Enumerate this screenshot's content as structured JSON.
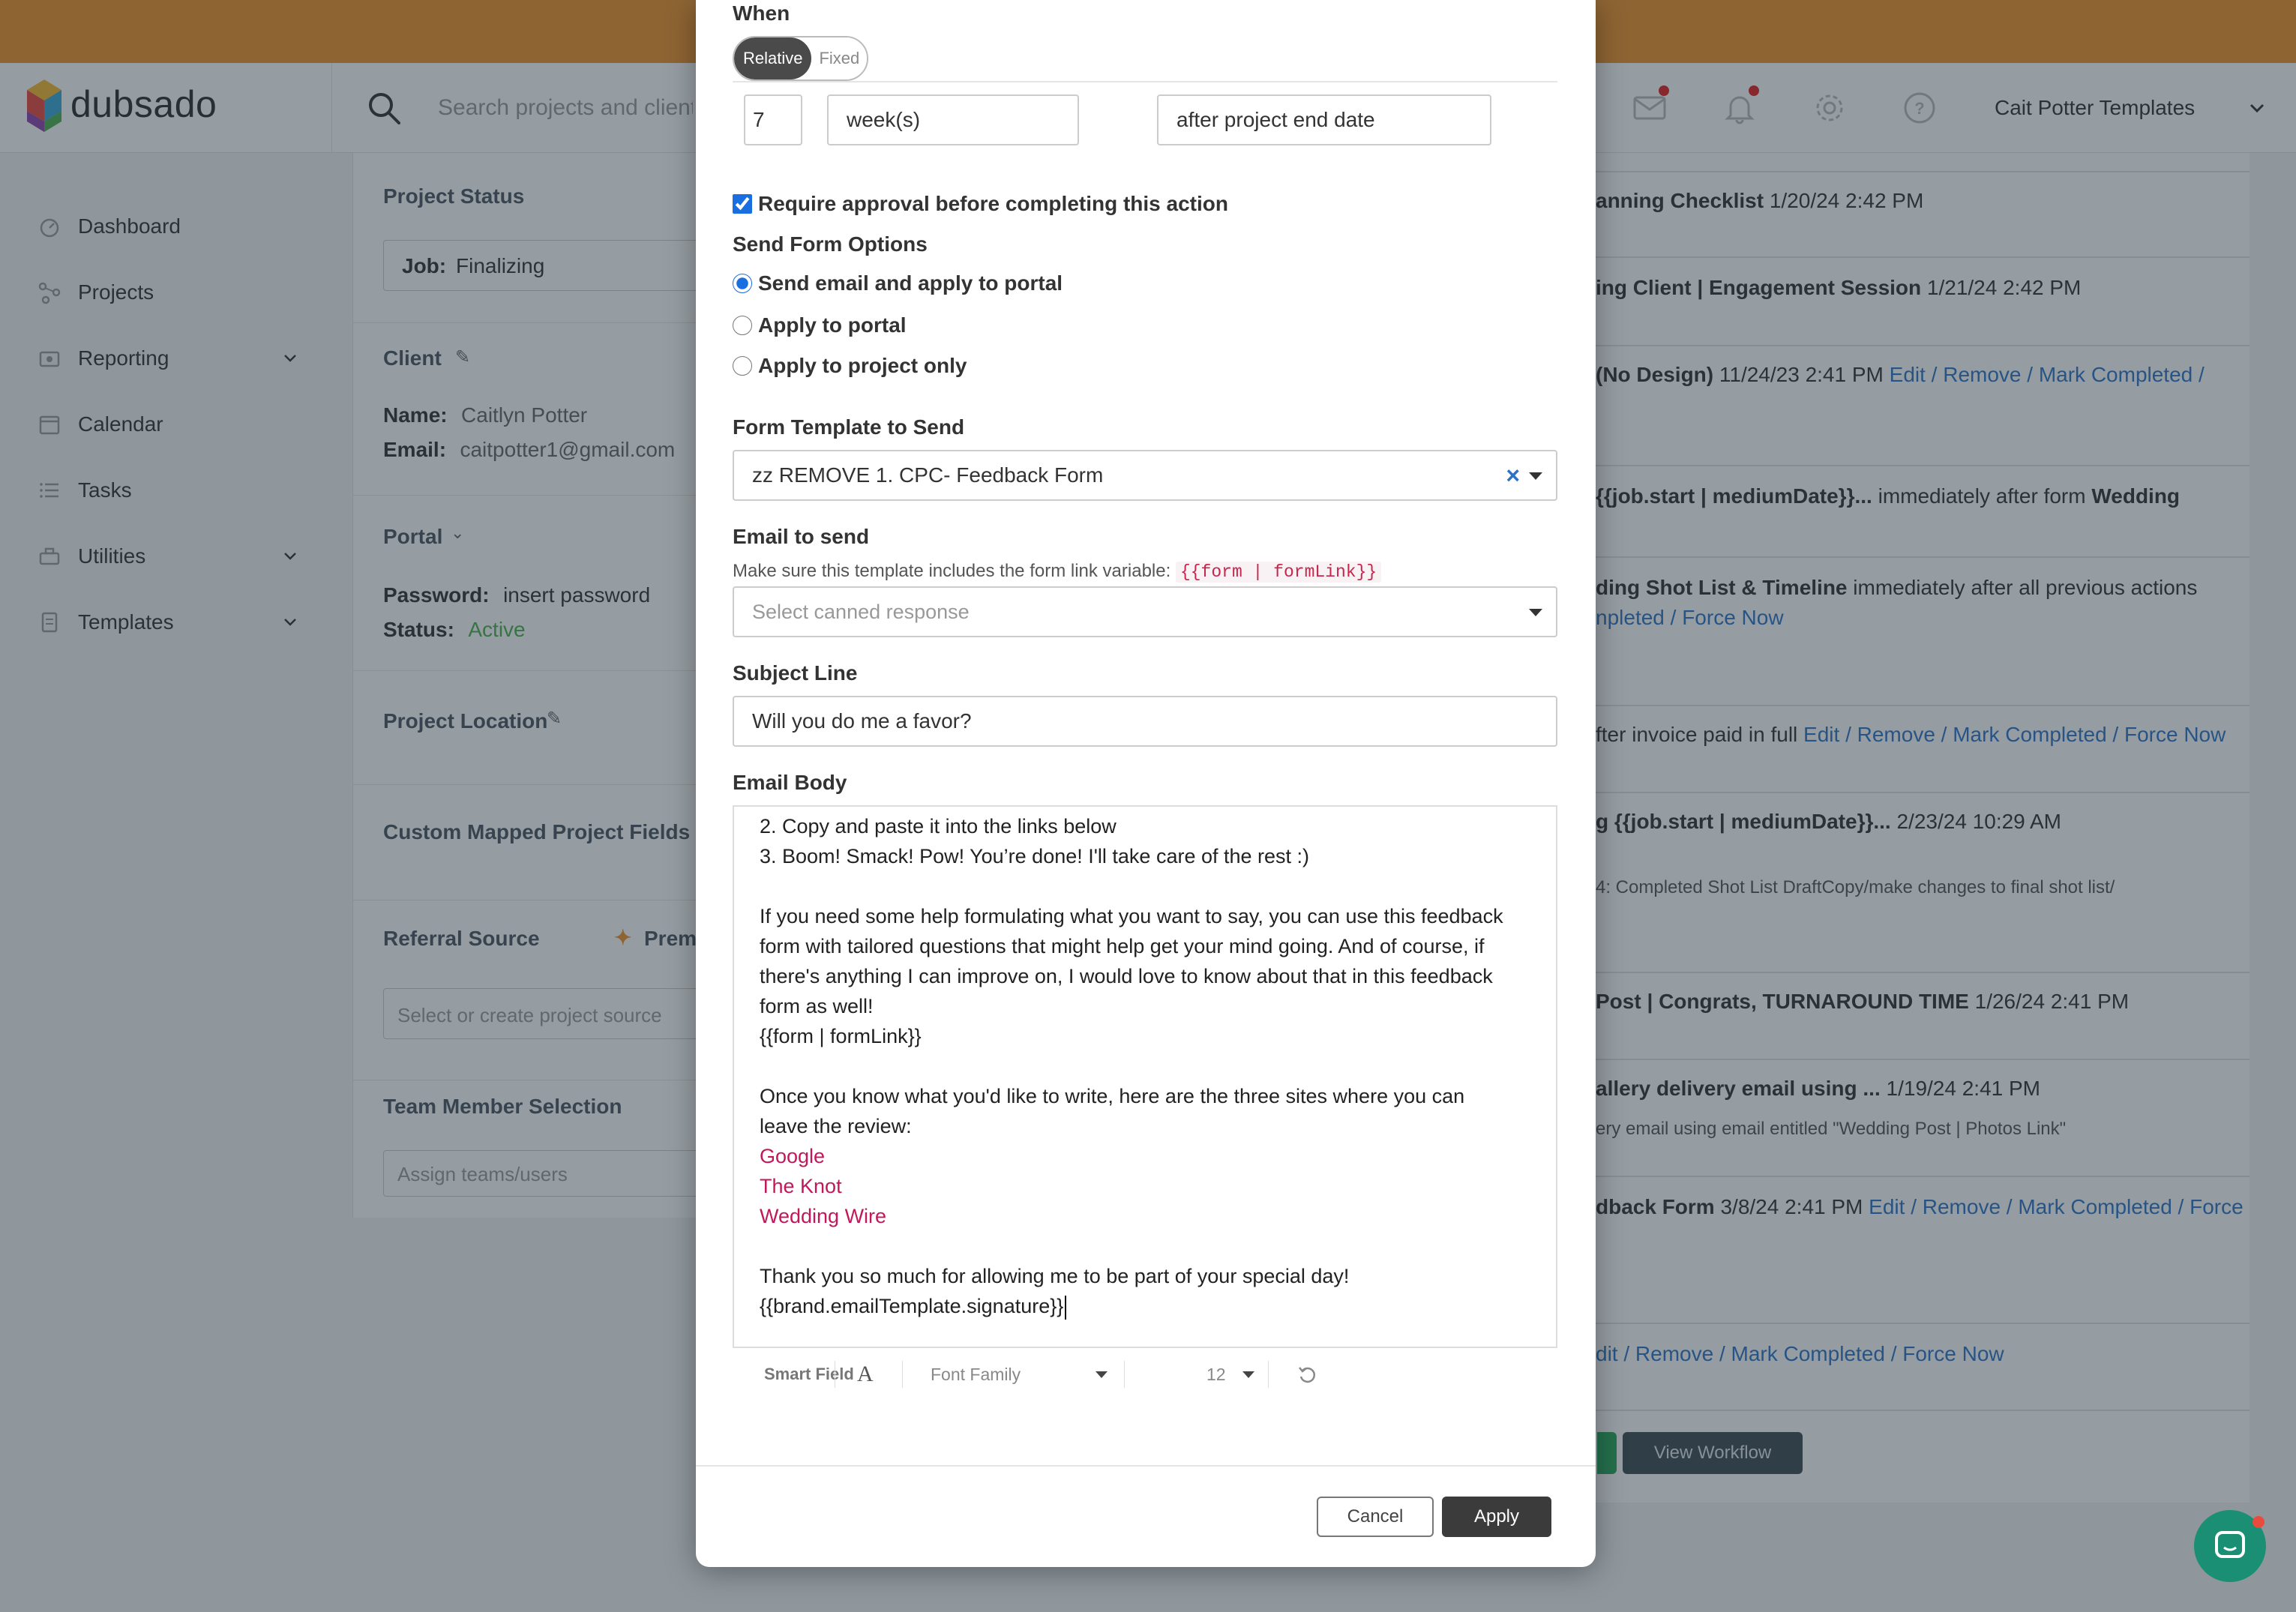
{
  "app": {
    "brand": "dubsado",
    "search_placeholder": "Search projects and clients",
    "account_name": "Cait Potter Templates"
  },
  "sidebar": {
    "items": [
      {
        "label": "Dashboard",
        "icon": "dashboard-icon"
      },
      {
        "label": "Projects",
        "icon": "projects-icon"
      },
      {
        "label": "Reporting",
        "icon": "reporting-icon"
      },
      {
        "label": "Calendar",
        "icon": "calendar-icon"
      },
      {
        "label": "Tasks",
        "icon": "tasks-icon"
      },
      {
        "label": "Utilities",
        "icon": "utilities-icon"
      },
      {
        "label": "Templates",
        "icon": "templates-icon"
      }
    ]
  },
  "project_panel": {
    "status_title": "Project Status",
    "status_prefix": "Job:",
    "status_value": "Finalizing",
    "client_title": "Client",
    "name_label": "Name:",
    "name_value": "Caitlyn Potter",
    "email_label": "Email:",
    "email_value": "caitpotter1@gmail.com",
    "portal_title": "Portal",
    "password_label": "Password:",
    "password_value": "insert password",
    "status_label": "Status:",
    "status_active": "Active",
    "location_title": "Project Location",
    "custom_fields_title": "Custom Mapped Project Fields",
    "referral_title": "Referral Source",
    "premium_label": "Prem",
    "referral_placeholder": "Select or create project source",
    "team_title": "Team Member Selection",
    "team_placeholder": "Assign teams/users"
  },
  "workflow_panel": {
    "rows": [
      {
        "bold": "anning Checklist",
        "text": " 1/20/24 2:42 PM",
        "links": ""
      },
      {
        "bold": "ing Client | Engagement Session",
        "text": " 1/21/24 2:42 PM",
        "links": ""
      },
      {
        "bold": "(No Design)",
        "text": " 11/24/23 2:41 PM ",
        "links": "Edit / Remove / Mark Completed /"
      },
      {
        "bold": "{{job.start | mediumDate}}...",
        "text": " immediately after form ",
        "bold2": "Wedding"
      },
      {
        "bold": "ding Shot List & Timeline",
        "text": " immediately after all previous actions"
      },
      {
        "bold": "",
        "text": "fter invoice paid in full ",
        "links": "Edit / Remove / Mark Completed / Force Now"
      },
      {
        "bold": "g {{job.start | mediumDate}}...",
        "text": " 2/23/24 10:29 AM"
      },
      {
        "bold": "Post | Congrats, TURNAROUND TIME",
        "text": " 1/26/24 2:41 PM"
      },
      {
        "bold": "allery delivery email using ...",
        "text": " 1/19/24 2:41 PM"
      },
      {
        "bold": "dback Form",
        "text": " 3/8/24 2:41 PM ",
        "links": "Edit / Remove / Mark Completed / Force"
      }
    ],
    "sub_row_1": "npleted / Force Now",
    "sub_row_2": "4: Completed Shot List DraftCopy/make changes to final shot list/",
    "sub_row_3": "ery email using email entitled \"Wedding Post | Photos Link\"",
    "bottom_links": "dit / Remove / Mark Completed / Force Now",
    "view_workflow": "View Workflow"
  },
  "modal": {
    "when_label": "When",
    "seg_relative": "Relative",
    "seg_fixed": "Fixed",
    "amount": "7",
    "unit": "week(s)",
    "trigger": "after project end date",
    "require_approval": "Require approval before completing this action",
    "send_form_options": "Send Form Options",
    "radio_1": "Send email and apply to portal",
    "radio_2": "Apply to portal",
    "radio_3": "Apply to project only",
    "form_template_label": "Form Template to Send",
    "form_template_value": "zz REMOVE 1. CPC- Feedback Form",
    "email_label": "Email to send",
    "email_help": "Make sure this template includes the form link variable: ",
    "email_help_code": "{{form | formLink}}",
    "canned_placeholder": "Select canned response",
    "subject_label": "Subject Line",
    "subject_value": "Will you do me a favor?",
    "body_label": "Email Body",
    "body": {
      "l1": "2. Copy and paste it into the links below",
      "l2": "3. Boom! Smack! Pow! You’re done! I'll take care of the rest :)",
      "l3": "If you need some help formulating what you want to say, you can use this feedback",
      "l4": "form with tailored questions that might help get your mind going. And of course, if",
      "l5": "there's anything I can improve on, I would love to know about that in this feedback",
      "l6": "form as well!",
      "l7": "{{form | formLink}}",
      "l8": "Once you know what you'd like to write, here are the three sites where you can",
      "l9": "leave the review:",
      "link1": "Google",
      "link2": "The Knot",
      "link3": "Wedding Wire",
      "l10": "Thank you so much for allowing me to be part of your special day!",
      "l11": "{{brand.emailTemplate.signature}}"
    },
    "toolbar": {
      "smart_field": "Smart Field",
      "font_a": "A",
      "font_family": "Font Family",
      "font_size": "12"
    },
    "cancel": "Cancel",
    "apply": "Apply"
  },
  "colors": {
    "top_banner": "#f0922b",
    "link_blue": "#2b73c8",
    "active_green": "#4caf50",
    "email_link": "#c2185b",
    "apply_button": "#3b3b3b",
    "chat_bubble": "#1b8f73"
  }
}
